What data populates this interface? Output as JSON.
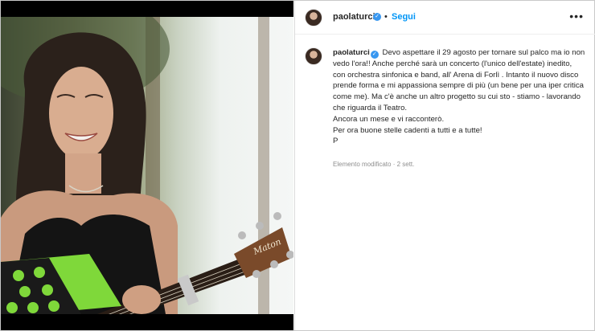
{
  "header": {
    "username": "paolaturci",
    "separator": "•",
    "follow_label": "Segui",
    "more_label": "•••"
  },
  "caption": {
    "username": "paolaturci",
    "text": "Devo aspettare il 29 agosto per tornare sul palco ma io non vedo l'ora!! Anche perché sarà un concerto (l'unico dell'estate) inedito, con orchestra sinfonica e band, all' Arena di Forlì . Intanto il nuovo disco prende forma e mi appassiona sempre di più (un bene per una iper critica come me). Ma c'è anche un altro progetto su cui sto - stiamo - lavorando che riguarda il Teatro.",
    "line2": "Ancora un mese e vi racconterò.",
    "line3": "Per ora buone stelle cadenti a tutti e a tutte!",
    "line4": "P",
    "meta": "Elemento modificato · 2 sett."
  },
  "media": {
    "guitar_brand": "Maton"
  },
  "colors": {
    "accent": "#0095f6",
    "verified": "#3897f0",
    "text": "#262626",
    "secondary": "#8e8e8e"
  }
}
